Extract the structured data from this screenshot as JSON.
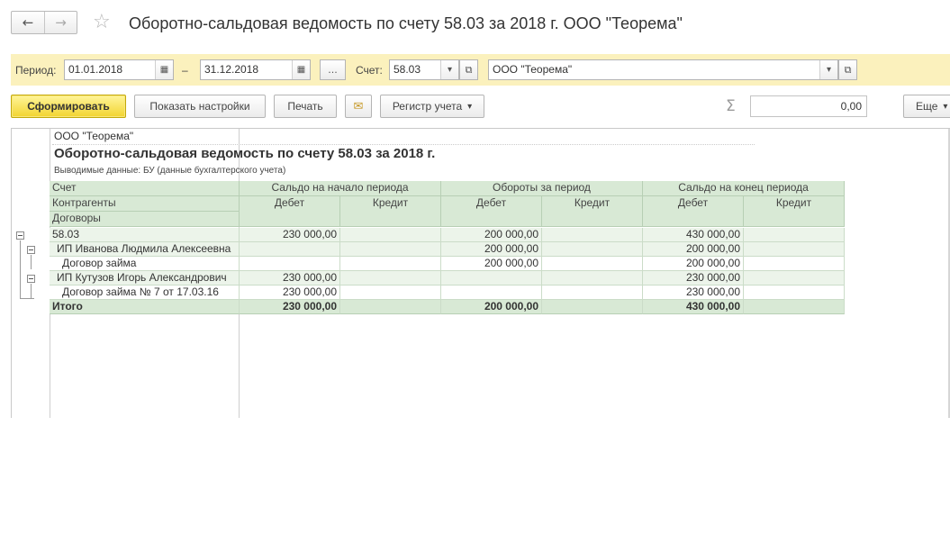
{
  "window": {
    "title": "Оборотно-сальдовая ведомость по счету 58.03 за 2018 г. ООО \"Теорема\"",
    "back_icon": "←",
    "forward_icon": "→",
    "star_icon": "☆"
  },
  "period_panel": {
    "period_label": "Период:",
    "date_from": "01.01.2018",
    "dash": "–",
    "date_to": "31.12.2018",
    "ellipsis_label": "...",
    "account_label": "Счет:",
    "account_value": "58.03",
    "organization_value": "ООО \"Теорема\"",
    "calendar_icon": "▦",
    "dropdown_icon": "▾",
    "open_icon": "⧉"
  },
  "toolbar": {
    "generate_label": "Сформировать",
    "show_settings_label": "Показать настройки",
    "print_label": "Печать",
    "mail_icon": "✉",
    "register_label": "Регистр учета",
    "register_dropdown_icon": "▾",
    "sigma_icon": "Σ",
    "sum_value": "0,00",
    "more_label": "Еще",
    "more_dropdown_icon": "▾"
  },
  "report": {
    "organization": "ООО \"Теорема\"",
    "title": "Оборотно-сальдовая ведомость по счету 58.03 за 2018 г.",
    "meta": "Выводимые данные:  БУ (данные бухгалтерского учета)",
    "headers": {
      "account": "Счет",
      "counterparties": "Контрагенты",
      "contracts": "Договоры",
      "opening_balance": "Сальдо на начало периода",
      "turnover": "Обороты за период",
      "closing_balance": "Сальдо на конец периода",
      "debit": "Дебет",
      "credit": "Кредит"
    },
    "rows": [
      {
        "name": "58.03",
        "open_debit": "230 000,00",
        "open_credit": "",
        "turn_debit": "200 000,00",
        "turn_credit": "",
        "close_debit": "430 000,00",
        "close_credit": ""
      },
      {
        "name": "ИП Иванова Людмила Алексеевна",
        "open_debit": "",
        "open_credit": "",
        "turn_debit": "200 000,00",
        "turn_credit": "",
        "close_debit": "200 000,00",
        "close_credit": ""
      },
      {
        "name": "Договор займа",
        "open_debit": "",
        "open_credit": "",
        "turn_debit": "200 000,00",
        "turn_credit": "",
        "close_debit": "200 000,00",
        "close_credit": ""
      },
      {
        "name": "ИП Кутузов Игорь Александрович",
        "open_debit": "230 000,00",
        "open_credit": "",
        "turn_debit": "",
        "turn_credit": "",
        "close_debit": "230 000,00",
        "close_credit": ""
      },
      {
        "name": "Договор займа № 7 от 17.03.16",
        "open_debit": "230 000,00",
        "open_credit": "",
        "turn_debit": "",
        "turn_credit": "",
        "close_debit": "230 000,00",
        "close_credit": ""
      }
    ],
    "total": {
      "name": "Итого",
      "open_debit": "230 000,00",
      "open_credit": "",
      "turn_debit": "200 000,00",
      "turn_credit": "",
      "close_debit": "430 000,00",
      "close_credit": ""
    }
  }
}
